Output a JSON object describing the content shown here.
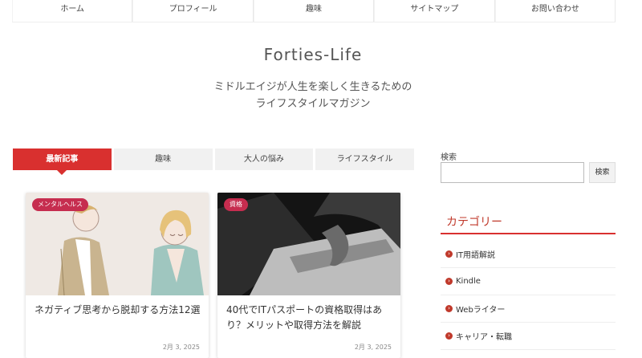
{
  "nav": {
    "items": [
      "ホーム",
      "プロフィール",
      "趣味",
      "サイトマップ",
      "お問い合わせ"
    ]
  },
  "site": {
    "title": "Forties-Life",
    "tagline_line1": "ミドルエイジが人生を楽しく生きるための",
    "tagline_line2": "ライフスタイルマガジン"
  },
  "tabs": [
    "最新記事",
    "趣味",
    "大人の悩み",
    "ライフスタイル"
  ],
  "cards": [
    {
      "category": "メンタルヘルス",
      "title": "ネガティブ思考から脱却する方法12選",
      "date": "2月 3, 2025"
    },
    {
      "category": "資格",
      "title": "40代でITパスポートの資格取得はあり？メリットや取得方法を解説",
      "date": "2月 3, 2025"
    }
  ],
  "sidebar": {
    "search_label": "検索",
    "search_placeholder": "",
    "search_button": "検索",
    "category_heading": "カテゴリー",
    "categories": [
      "IT用語解説",
      "Kindle",
      "Webライター",
      "キャリア・転職"
    ]
  },
  "colors": {
    "accent": "#d9302f",
    "badge": "#c62d4f"
  }
}
